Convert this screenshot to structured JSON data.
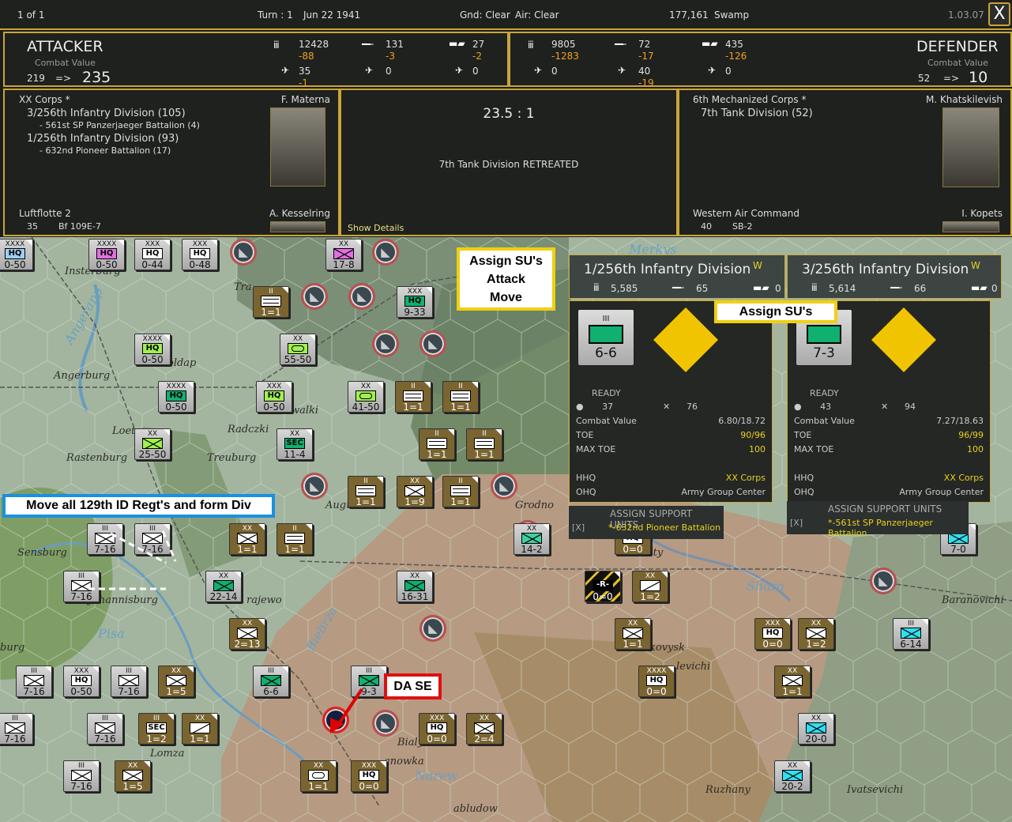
{
  "topbar": {
    "page": "1 of 1",
    "turn": "Turn : 1",
    "date": "Jun 22 1941",
    "ground": "Gnd: Clear",
    "air": "Air: Clear",
    "hex": "177,161",
    "terrain": "Swamp",
    "version": "1.03.07",
    "close": "X"
  },
  "attacker": {
    "title": "ATTACKER",
    "cv_label": "Combat Value",
    "cv_from": "219",
    "arrow": "=>",
    "cv_to": "235",
    "men": "12428",
    "men_loss": "-88",
    "guns": "131",
    "guns_loss": "-3",
    "afv": "27",
    "afv_loss": "-2",
    "fighters": "35",
    "fighters_loss": "-1",
    "bombers": "0",
    "other_air": "0"
  },
  "defender": {
    "title": "DEFENDER",
    "cv_label": "Combat Value",
    "cv_from": "52",
    "arrow": "=>",
    "cv_to": "10",
    "men": "9805",
    "men_loss": "-1283",
    "guns": "72",
    "guns_loss": "-17",
    "afv": "435",
    "afv_loss": "-126",
    "fighters": "0",
    "bombers": "40",
    "bombers_loss": "-19",
    "other_air": "0"
  },
  "combat": {
    "att_corps": "XX Corps *",
    "att_leader": "F. Materna",
    "att_units": [
      "3/256th Infantry Division (105)",
      "- 561st SP Panzerjaeger Battalion (4)",
      "1/256th Infantry Division (93)",
      "- 632nd Pioneer Battalion (17)"
    ],
    "att_air": "Luftflotte 2",
    "att_air_leader": "A. Kesselring",
    "att_air_count": "35",
    "att_air_type": "Bf 109E-7",
    "odds": "23.5 : 1",
    "result": "7th Tank Division RETREATED",
    "show_details": "Show Details",
    "def_corps": "6th Mechanized Corps *",
    "def_leader": "M. Khatskilevish",
    "def_units": [
      "7th Tank Division (52)"
    ],
    "def_air": "Western Air Command",
    "def_air_leader": "I. Kopets",
    "def_air_count": "40",
    "def_air_type": "SB-2"
  },
  "unit_details": [
    {
      "name": "1/256th Infantry Division",
      "badge": "W",
      "men": "5,585",
      "guns": "65",
      "afv": "0",
      "size": "III",
      "strength": "6-6",
      "status": "READY",
      "supply": "37",
      "fatigue": "76",
      "cv_label": "Combat Value",
      "cv": "6.80/18.72",
      "toe_label": "TOE",
      "toe": "90/96",
      "maxtoe_label": "MAX TOE",
      "maxtoe": "100",
      "hhq_label": "HHQ",
      "hhq": "XX Corps",
      "ohq_label": "OHQ",
      "ohq": "Army Group Center",
      "su_header": "ASSIGN SUPPORT UNITS",
      "su_x": "[X]",
      "su_unit": "*-632nd Pioneer Battalion"
    },
    {
      "name": "3/256th Infantry Division",
      "badge": "W",
      "men": "5,614",
      "guns": "66",
      "afv": "0",
      "size": "III",
      "strength": "7-3",
      "status": "READY",
      "supply": "43",
      "fatigue": "94",
      "cv_label": "Combat Value",
      "cv": "7.27/18.63",
      "toe_label": "TOE",
      "toe": "96/99",
      "maxtoe_label": "MAX TOE",
      "maxtoe": "100",
      "hhq_label": "HHQ",
      "hhq": "XX Corps",
      "ohq_label": "OHQ",
      "ohq": "Army Group Center",
      "su_header": "ASSIGN SUPPORT UNITS",
      "su_x": "[X]",
      "su_unit": "*-561st SP Panzerjaeger Battalion"
    }
  ],
  "annotations": {
    "assign_attack_move": [
      "Assign SU's",
      "Attack",
      "Move"
    ],
    "assign_su": "Assign SU's",
    "move_129": "Move all 129th ID Regt's and form Div",
    "da_se": "DA SE"
  },
  "places": [
    "Insterburg",
    "Angerapp",
    "Angerburg",
    "oldap",
    "Loet",
    "Rastenburg",
    "Treuburg",
    "Radczki",
    "walki",
    "Tra",
    "Sensburg",
    "Johannisburg",
    "Pisa",
    "rajewo",
    "Biebrza",
    "burg",
    "Lomza",
    "Augustow",
    "Grodno",
    "Bialystok",
    "anowka",
    "Narew",
    "abludow",
    "sty",
    "kovysk",
    "levichi",
    "Shara",
    "Baranovichi",
    "Ruzhany",
    "Ivatsevichi",
    "Merkys"
  ],
  "counters": [
    {
      "side": "g",
      "size": "XXXX",
      "sym": "HQ",
      "color": "#9ad0f0",
      "value": "0-50"
    },
    {
      "side": "g",
      "size": "XXXX",
      "sym": "HQ",
      "color": "#e070e0",
      "value": "0-50"
    },
    {
      "side": "g",
      "size": "XXX",
      "sym": "HQ",
      "color": "#ffffff",
      "value": "0-44"
    },
    {
      "side": "g",
      "size": "XXX",
      "sym": "HQ",
      "color": "#ffffff",
      "value": "0-48"
    },
    {
      "side": "g",
      "size": "XX",
      "sym": "X",
      "color": "#e070e0",
      "value": "17-8"
    },
    {
      "side": "s",
      "size": "II",
      "sym": "M",
      "color": "#ffffff",
      "value": "1=1"
    },
    {
      "side": "g",
      "size": "XXX",
      "sym": "HQ",
      "color": "#10b070",
      "value": "9-33"
    },
    {
      "side": "g",
      "size": "XXXX",
      "sym": "HQ",
      "color": "#a0f050",
      "value": "0-50"
    },
    {
      "side": "g",
      "size": "XX",
      "sym": "O",
      "color": "#a0f050",
      "value": "55-50"
    },
    {
      "side": "g",
      "size": "XXXX",
      "sym": "HQ",
      "color": "#10b070",
      "value": "0-50"
    },
    {
      "side": "g",
      "size": "XXX",
      "sym": "HQ",
      "color": "#a0f050",
      "value": "0-50"
    },
    {
      "side": "g",
      "size": "XX",
      "sym": "O",
      "color": "#a0f050",
      "value": "41-50"
    },
    {
      "side": "s",
      "size": "II",
      "sym": "M",
      "color": "#ffffff",
      "value": "1=1"
    },
    {
      "side": "s",
      "size": "II",
      "sym": "M",
      "color": "#ffffff",
      "value": "1=1"
    },
    {
      "side": "g",
      "size": "XX",
      "sym": "X",
      "color": "#a0f050",
      "value": "25-50"
    },
    {
      "side": "g",
      "size": "XX",
      "sym": "SEC",
      "color": "#10b070",
      "value": "11-4"
    },
    {
      "side": "s",
      "size": "II",
      "sym": "M",
      "color": "#ffffff",
      "value": "1=1"
    },
    {
      "side": "s",
      "size": "II",
      "sym": "M",
      "color": "#ffffff",
      "value": "1=1"
    },
    {
      "side": "s",
      "size": "II",
      "sym": "M",
      "color": "#ffffff",
      "value": "1=1"
    },
    {
      "side": "s",
      "size": "XX",
      "sym": "X",
      "color": "#ffffff",
      "value": "1=9"
    },
    {
      "side": "s",
      "size": "II",
      "sym": "M",
      "color": "#ffffff",
      "value": "1=1"
    },
    {
      "side": "g",
      "size": "III",
      "sym": "X",
      "color": "#ffffff",
      "value": "7-16"
    },
    {
      "side": "g",
      "size": "III",
      "sym": "X",
      "color": "#ffffff",
      "value": "7-16"
    },
    {
      "side": "s",
      "size": "XX",
      "sym": "X",
      "color": "#ffffff",
      "value": "1=1"
    },
    {
      "side": "s",
      "size": "II",
      "sym": "M",
      "color": "#ffffff",
      "value": "1=1"
    },
    {
      "side": "g",
      "size": "XX",
      "sym": "X",
      "color": "#40d0a0",
      "value": "14-2"
    },
    {
      "side": "g",
      "size": "III",
      "sym": "X",
      "color": "#ffffff",
      "value": "7-16"
    },
    {
      "side": "g",
      "size": "XX",
      "sym": "X",
      "color": "#10b070",
      "value": "22-14"
    },
    {
      "side": "g",
      "size": "XX",
      "sym": "X",
      "color": "#10b070",
      "value": "16-31"
    },
    {
      "side": "s",
      "size": "XX",
      "sym": "X",
      "color": "#ffffff",
      "value": "2=13"
    },
    {
      "side": "g",
      "size": "III",
      "sym": "X",
      "color": "#ffffff",
      "value": "7-16"
    },
    {
      "side": "g",
      "size": "XXX",
      "sym": "HQ",
      "color": "#ffffff",
      "value": "0-50"
    },
    {
      "side": "g",
      "size": "III",
      "sym": "X",
      "color": "#ffffff",
      "value": "7-16"
    },
    {
      "side": "s",
      "size": "XX",
      "sym": "X",
      "color": "#ffffff",
      "value": "1=5"
    },
    {
      "side": "g",
      "size": "III",
      "sym": "X",
      "color": "#10b070",
      "value": "6-6"
    },
    {
      "side": "g",
      "size": "III",
      "sym": "X",
      "color": "#10b070",
      "value": "9-3"
    },
    {
      "side": "g",
      "size": "III",
      "sym": "X",
      "color": "#ffffff",
      "value": "7-16"
    },
    {
      "side": "g",
      "size": "III",
      "sym": "X",
      "color": "#ffffff",
      "value": "7-16"
    },
    {
      "side": "s",
      "size": "III",
      "sym": "SEC",
      "color": "#ffffff",
      "value": "1=2"
    },
    {
      "side": "s",
      "size": "XX",
      "sym": "/",
      "color": "#ffffff",
      "value": "1=1"
    },
    {
      "side": "s",
      "size": "XXX",
      "sym": "HQ",
      "color": "#ffffff",
      "value": "0=0"
    },
    {
      "side": "s",
      "size": "XX",
      "sym": "X",
      "color": "#ffffff",
      "value": "2=4"
    },
    {
      "side": "g",
      "size": "III",
      "sym": "X",
      "color": "#ffffff",
      "value": "7-16"
    },
    {
      "side": "s",
      "size": "XX",
      "sym": "X",
      "color": "#ffffff",
      "value": "1=5"
    },
    {
      "side": "s",
      "size": "XX",
      "sym": "O",
      "color": "#ffffff",
      "value": "1=1"
    },
    {
      "side": "s",
      "size": "XXX",
      "sym": "HQ",
      "color": "#ffffff",
      "value": "0=0"
    },
    {
      "side": "s",
      "size": "",
      "sym": "HQ",
      "color": "#ffffff",
      "value": "0=0"
    },
    {
      "side": "r",
      "size": "",
      "sym": "R",
      "color": "#ffffff",
      "value": "0=0"
    },
    {
      "side": "s",
      "size": "XX",
      "sym": "/",
      "color": "#ffffff",
      "value": "1=2"
    },
    {
      "side": "s",
      "size": "XX",
      "sym": "X",
      "color": "#ffffff",
      "value": "1=1"
    },
    {
      "side": "s",
      "size": "XXX",
      "sym": "HQ",
      "color": "#ffffff",
      "value": "0=0"
    },
    {
      "side": "s",
      "size": "XX",
      "sym": "X",
      "color": "#ffffff",
      "value": "1=2"
    },
    {
      "side": "s",
      "size": "XXXX",
      "sym": "HQ",
      "color": "#ffffff",
      "value": "0=0"
    },
    {
      "side": "s",
      "size": "XX",
      "sym": "X",
      "color": "#ffffff",
      "value": "1=1"
    },
    {
      "side": "g",
      "size": "III",
      "sym": "X",
      "color": "#30e0f0",
      "value": "6-14"
    },
    {
      "side": "g",
      "size": "XX",
      "sym": "X",
      "color": "#30e0f0",
      "value": "20-0"
    },
    {
      "side": "g",
      "size": "XX",
      "sym": "X",
      "color": "#30e0f0",
      "value": "20-2"
    },
    {
      "side": "g",
      "size": "",
      "sym": "X",
      "color": "#30e0f0",
      "value": "7-0"
    }
  ]
}
